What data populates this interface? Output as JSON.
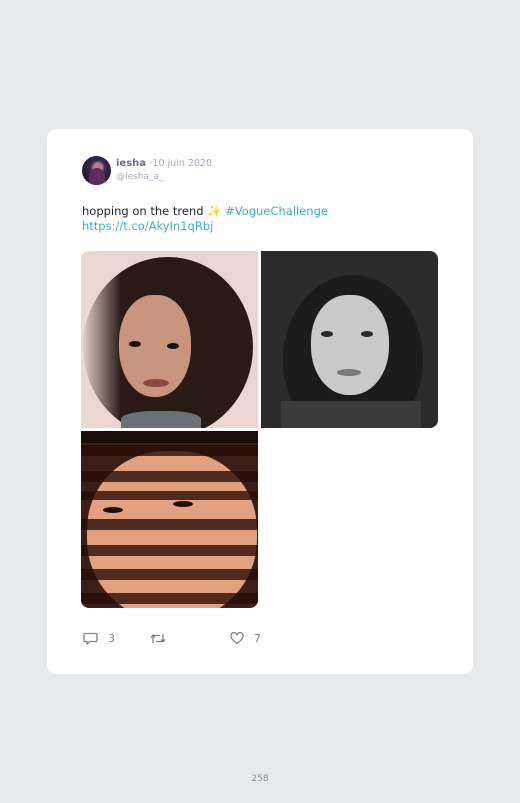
{
  "tweet": {
    "display_name": "iesha",
    "separator": "·",
    "date": "10 juin 2020",
    "handle": "@iesha_a_",
    "text": "hopping on the trend ",
    "sparkle": "✨",
    "hashtag": "#VogueChallenge",
    "link": "https://t.co/AkyIn1qRbj",
    "media": [
      {
        "alt": "portrait-color"
      },
      {
        "alt": "portrait-black-and-white"
      },
      {
        "alt": "portrait-light-stripes"
      }
    ]
  },
  "actions": {
    "reply_icon": "reply-icon",
    "reply_count": "3",
    "retweet_icon": "retweet-icon",
    "retweet_count": "",
    "like_icon": "heart-icon",
    "like_count": "7"
  },
  "colors": {
    "accent": "#3ea9dd",
    "name": "#6a6e87",
    "muted": "#a7abb8",
    "background": "#e8e9eb"
  },
  "page_number": "258"
}
